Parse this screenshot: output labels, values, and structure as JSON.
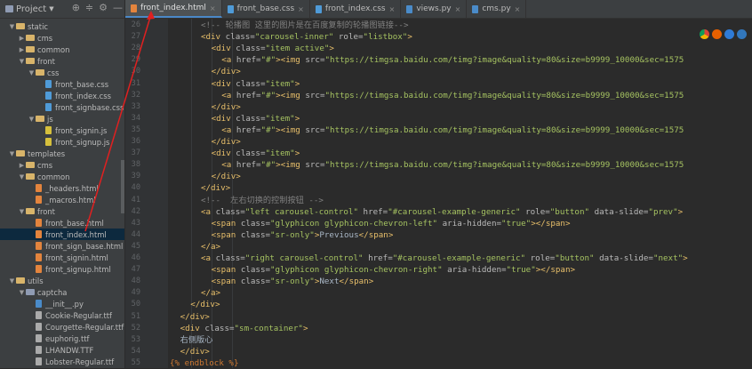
{
  "project": {
    "title": "Project",
    "tree": [
      {
        "label": "static",
        "kind": "folder",
        "depth": 1,
        "open": true
      },
      {
        "label": "cms",
        "kind": "folder",
        "depth": 2,
        "open": false
      },
      {
        "label": "common",
        "kind": "folder",
        "depth": 2,
        "open": false
      },
      {
        "label": "front",
        "kind": "folder",
        "depth": 2,
        "open": true
      },
      {
        "label": "css",
        "kind": "folder",
        "depth": 3,
        "open": true
      },
      {
        "label": "front_base.css",
        "kind": "css",
        "depth": 4
      },
      {
        "label": "front_index.css",
        "kind": "css",
        "depth": 4
      },
      {
        "label": "front_signbase.css",
        "kind": "css",
        "depth": 4
      },
      {
        "label": "js",
        "kind": "folder",
        "depth": 3,
        "open": true
      },
      {
        "label": "front_signin.js",
        "kind": "js",
        "depth": 4
      },
      {
        "label": "front_signup.js",
        "kind": "js",
        "depth": 4
      },
      {
        "label": "templates",
        "kind": "folder",
        "depth": 1,
        "open": true
      },
      {
        "label": "cms",
        "kind": "folder",
        "depth": 2,
        "open": false
      },
      {
        "label": "common",
        "kind": "folder",
        "depth": 2,
        "open": true
      },
      {
        "label": "_headers.html",
        "kind": "html",
        "depth": 3
      },
      {
        "label": "_macros.html",
        "kind": "html",
        "depth": 3
      },
      {
        "label": "front",
        "kind": "folder",
        "depth": 2,
        "open": true
      },
      {
        "label": "front_base.html",
        "kind": "html",
        "depth": 3
      },
      {
        "label": "front_index.html",
        "kind": "html",
        "depth": 3,
        "selected": true
      },
      {
        "label": "front_sign_base.html",
        "kind": "html",
        "depth": 3
      },
      {
        "label": "front_signin.html",
        "kind": "html",
        "depth": 3
      },
      {
        "label": "front_signup.html",
        "kind": "html",
        "depth": 3
      },
      {
        "label": "utils",
        "kind": "folder",
        "depth": 1,
        "open": true
      },
      {
        "label": "captcha",
        "kind": "pkg",
        "depth": 2,
        "open": true
      },
      {
        "label": "__init__.py",
        "kind": "py",
        "depth": 3
      },
      {
        "label": "Cookie-Regular.ttf",
        "kind": "ttf",
        "depth": 3
      },
      {
        "label": "Courgette-Regular.ttf",
        "kind": "ttf",
        "depth": 3
      },
      {
        "label": "euphorig.ttf",
        "kind": "ttf",
        "depth": 3
      },
      {
        "label": "LHANDW.TTF",
        "kind": "ttf",
        "depth": 3
      },
      {
        "label": "Lobster-Regular.ttf",
        "kind": "ttf",
        "depth": 3
      }
    ]
  },
  "tabs": [
    {
      "label": "front_index.html",
      "kind": "html",
      "active": true
    },
    {
      "label": "front_base.css",
      "kind": "css"
    },
    {
      "label": "front_index.css",
      "kind": "css"
    },
    {
      "label": "views.py",
      "kind": "py"
    },
    {
      "label": "cms.py",
      "kind": "py"
    }
  ],
  "editor": {
    "line_numbers": [
      "26",
      "27",
      "28",
      "29",
      "30",
      "31",
      "32",
      "33",
      "34",
      "35",
      "36",
      "37",
      "38",
      "39",
      "40",
      "41",
      "42",
      "43",
      "44",
      "45",
      "46",
      "47",
      "48",
      "49",
      "50",
      "51",
      "52",
      "53",
      "54",
      "55"
    ],
    "lines": [
      {
        "indent": 6,
        "segs": [
          [
            "cm",
            "<!-- 轮播图 这里的图片是在百度复制的轮播图链接-->"
          ]
        ]
      },
      {
        "indent": 6,
        "segs": [
          [
            "t",
            "<div "
          ],
          [
            "a",
            "class="
          ],
          [
            "v",
            "\"carousel-inner\" "
          ],
          [
            "a",
            "role="
          ],
          [
            "v",
            "\"listbox\""
          ],
          [
            "t",
            ">"
          ]
        ]
      },
      {
        "indent": 8,
        "segs": [
          [
            "t",
            "<div "
          ],
          [
            "a",
            "class="
          ],
          [
            "v",
            "\"item active\""
          ],
          [
            "t",
            ">"
          ]
        ]
      },
      {
        "indent": 10,
        "segs": [
          [
            "t",
            "<a "
          ],
          [
            "a",
            "href="
          ],
          [
            "v",
            "\"#\""
          ],
          [
            "t",
            "><img "
          ],
          [
            "a",
            "src="
          ],
          [
            "v",
            "\"https://timgsa.baidu.com/timg?image&quality=80&size=b9999_10000&sec=1575"
          ]
        ]
      },
      {
        "indent": 8,
        "segs": [
          [
            "t",
            "</div>"
          ]
        ]
      },
      {
        "indent": 8,
        "segs": [
          [
            "t",
            "<div "
          ],
          [
            "a",
            "class="
          ],
          [
            "v",
            "\"item\""
          ],
          [
            "t",
            ">"
          ]
        ]
      },
      {
        "indent": 10,
        "segs": [
          [
            "t",
            "<a "
          ],
          [
            "a",
            "href="
          ],
          [
            "v",
            "\"#\""
          ],
          [
            "t",
            "><img "
          ],
          [
            "a",
            "src="
          ],
          [
            "v",
            "\"https://timgsa.baidu.com/timg?image&quality=80&size=b9999_10000&sec=1575"
          ]
        ]
      },
      {
        "indent": 8,
        "segs": [
          [
            "t",
            "</div>"
          ]
        ]
      },
      {
        "indent": 8,
        "segs": [
          [
            "t",
            "<div "
          ],
          [
            "a",
            "class="
          ],
          [
            "v",
            "\"item\""
          ],
          [
            "t",
            ">"
          ]
        ]
      },
      {
        "indent": 10,
        "segs": [
          [
            "t",
            "<a "
          ],
          [
            "a",
            "href="
          ],
          [
            "v",
            "\"#\""
          ],
          [
            "t",
            "><img "
          ],
          [
            "a",
            "src="
          ],
          [
            "v",
            "\"https://timgsa.baidu.com/timg?image&quality=80&size=b9999_10000&sec=1575"
          ]
        ]
      },
      {
        "indent": 8,
        "segs": [
          [
            "t",
            "</div>"
          ]
        ]
      },
      {
        "indent": 8,
        "segs": [
          [
            "t",
            "<div "
          ],
          [
            "a",
            "class="
          ],
          [
            "v",
            "\"item\""
          ],
          [
            "t",
            ">"
          ]
        ]
      },
      {
        "indent": 10,
        "segs": [
          [
            "t",
            "<a "
          ],
          [
            "a",
            "href="
          ],
          [
            "v",
            "\"#\""
          ],
          [
            "t",
            "><img "
          ],
          [
            "a",
            "src="
          ],
          [
            "v",
            "\"https://timgsa.baidu.com/timg?image&quality=80&size=b9999_10000&sec=1575"
          ]
        ]
      },
      {
        "indent": 8,
        "segs": [
          [
            "t",
            "</div>"
          ]
        ]
      },
      {
        "indent": 6,
        "segs": [
          [
            "t",
            "</div>"
          ]
        ]
      },
      {
        "indent": 6,
        "segs": [
          [
            "cm",
            "<!--  左右切换的控制按钮 -->"
          ]
        ]
      },
      {
        "indent": 6,
        "segs": [
          [
            "t",
            "<a "
          ],
          [
            "a",
            "class="
          ],
          [
            "v",
            "\"left carousel-control\" "
          ],
          [
            "a",
            "href="
          ],
          [
            "v",
            "\"#carousel-example-generic\" "
          ],
          [
            "a",
            "role="
          ],
          [
            "v",
            "\"button\" "
          ],
          [
            "a",
            "data-slide="
          ],
          [
            "v",
            "\"prev\""
          ],
          [
            "t",
            ">"
          ]
        ]
      },
      {
        "indent": 8,
        "segs": [
          [
            "t",
            "<span "
          ],
          [
            "a",
            "class="
          ],
          [
            "v",
            "\"glyphicon glyphicon-chevron-left\" "
          ],
          [
            "a",
            "aria-hidden="
          ],
          [
            "v",
            "\"true\""
          ],
          [
            "t",
            "></span>"
          ]
        ]
      },
      {
        "indent": 8,
        "segs": [
          [
            "t",
            "<span "
          ],
          [
            "a",
            "class="
          ],
          [
            "v",
            "\"sr-only\""
          ],
          [
            "t",
            ">"
          ],
          [
            "w",
            "Previous"
          ],
          [
            "t",
            "</span>"
          ]
        ]
      },
      {
        "indent": 6,
        "segs": [
          [
            "t",
            "</a>"
          ]
        ]
      },
      {
        "indent": 6,
        "segs": [
          [
            "t",
            "<a "
          ],
          [
            "a",
            "class="
          ],
          [
            "v",
            "\"right carousel-control\" "
          ],
          [
            "a",
            "href="
          ],
          [
            "v",
            "\"#carousel-example-generic\" "
          ],
          [
            "a",
            "role="
          ],
          [
            "v",
            "\"button\" "
          ],
          [
            "a",
            "data-slide="
          ],
          [
            "v",
            "\"next\""
          ],
          [
            "t",
            ">"
          ]
        ]
      },
      {
        "indent": 8,
        "segs": [
          [
            "t",
            "<span "
          ],
          [
            "a",
            "class="
          ],
          [
            "v",
            "\"glyphicon glyphicon-chevron-right\" "
          ],
          [
            "a",
            "aria-hidden="
          ],
          [
            "v",
            "\"true\""
          ],
          [
            "t",
            "></span>"
          ]
        ]
      },
      {
        "indent": 8,
        "segs": [
          [
            "t",
            "<span "
          ],
          [
            "a",
            "class="
          ],
          [
            "v",
            "\"sr-only\""
          ],
          [
            "t",
            ">"
          ],
          [
            "w",
            "Next"
          ],
          [
            "t",
            "</span>"
          ]
        ]
      },
      {
        "indent": 6,
        "segs": [
          [
            "t",
            "</a>"
          ]
        ]
      },
      {
        "indent": 4,
        "segs": [
          [
            "t",
            "</div>"
          ]
        ]
      },
      {
        "indent": 2,
        "segs": [
          [
            "t",
            "</div>"
          ]
        ]
      },
      {
        "indent": 2,
        "segs": [
          [
            "t",
            "<div "
          ],
          [
            "a",
            "class="
          ],
          [
            "v",
            "\"sm-container\""
          ],
          [
            "t",
            ">"
          ]
        ]
      },
      {
        "indent": 2,
        "segs": [
          [
            "w",
            "右侧版心"
          ]
        ]
      },
      {
        "indent": 2,
        "segs": [
          [
            "t",
            "</div>"
          ]
        ]
      },
      {
        "indent": 0,
        "segs": [
          [
            "kw",
            "{% "
          ],
          [
            "kw",
            "endblock "
          ],
          [
            "kw",
            "%}"
          ]
        ]
      }
    ]
  },
  "colors": {
    "annotation": "#e02020",
    "accent": "#4a88c7"
  }
}
